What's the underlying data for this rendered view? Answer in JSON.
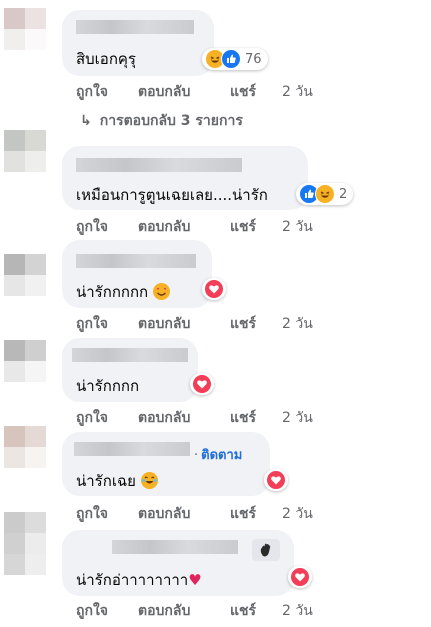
{
  "labels": {
    "like": "ถูกใจ",
    "reply": "ตอบกลับ",
    "share": "แชร์",
    "time": "2 วัน"
  },
  "view_replies": "การตอบกลับ 3 รายการ",
  "comments": [
    {
      "text": "สิบเอกคุรุ",
      "reactions": [
        "haha",
        "like"
      ],
      "reaction_count": "76"
    },
    {
      "text": "เหมือนการูตูนเฉยเลย....น่ารัก",
      "reactions": [
        "like",
        "haha"
      ],
      "reaction_count": "2"
    },
    {
      "text": "น่ารักกกกก",
      "reactions": [
        "love"
      ]
    },
    {
      "text": "น่ารักกกก",
      "reactions": [
        "love"
      ]
    },
    {
      "text": "น่ารักเฉย",
      "follow": "ติดตาม",
      "reactions": [
        "love"
      ]
    },
    {
      "text": "น่ารักอ่าาาาาาาา",
      "reactions": [
        "love"
      ],
      "badge": "wave-icon"
    }
  ],
  "colors": {
    "bubble": "#f0f2f5",
    "meta_text": "#65676b",
    "follow_link": "#216fdb",
    "love": "#f33e58",
    "like": "#1877f2",
    "haha": "#f7b125"
  }
}
